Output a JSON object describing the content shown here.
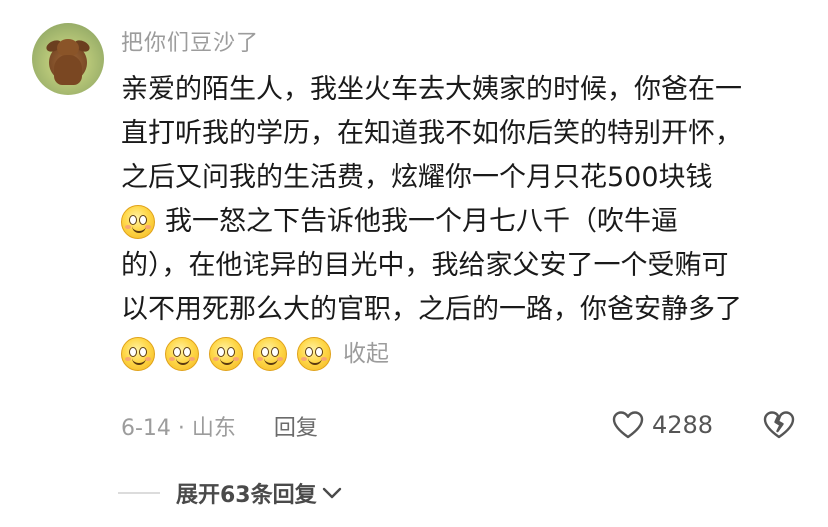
{
  "comment": {
    "username": "把你们豆沙了",
    "lines": [
      "亲爱的陌生人，我坐火车去大姨家的时候，你爸在一",
      "直打听我的学历，在知道我不如你后笑的特别开怀，",
      "之后又问我的生活费，炫耀你一个月只花500块钱",
      "我一怒之下告诉他我一个月七八千（吹牛逼",
      "的），在他诧异的目光中，我给家父安了一个受贿可",
      "以不用死那么大的官职，之后的一路，你爸安静多了"
    ],
    "collapse_label": "收起",
    "date_location": "6-14 · 山东",
    "reply_label": "回复",
    "like_count": "4288",
    "expand_replies_label": "展开63条回复",
    "emoji_icon": "smiling-face-emoji",
    "like_icon": "heart-outline-icon",
    "dislike_icon": "broken-heart-icon",
    "expand_icon": "chevron-down-icon"
  }
}
